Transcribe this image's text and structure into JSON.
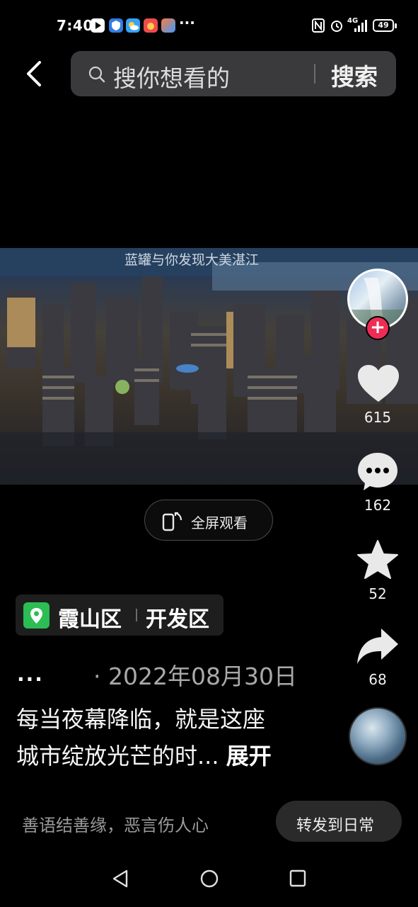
{
  "status_bar": {
    "time": "7:40",
    "dots": "···",
    "network": "4G",
    "battery": "49"
  },
  "search": {
    "placeholder": "搜你想看的",
    "button": "搜索"
  },
  "video": {
    "caption": "蓝罐与你发现大美湛江",
    "fullscreen_label": "全屏观看"
  },
  "rail": {
    "likes": "615",
    "comments": "162",
    "favorites": "52",
    "shares": "68"
  },
  "location": {
    "district": "霞山区",
    "area": "开发区"
  },
  "post": {
    "author_ellipsis": "...",
    "date": "· 2022年08月30日",
    "desc_line1": "每当夜幕降临，就是这座",
    "desc_line2": "城市绽放光芒的时...",
    "expand": "展开"
  },
  "bottom": {
    "comment_hint": "善语结善缘，恶言伤人心",
    "share_daily": "转发到日常"
  },
  "colors": {
    "like_red": "#ee2c55",
    "location_green": "#2cbd55"
  }
}
